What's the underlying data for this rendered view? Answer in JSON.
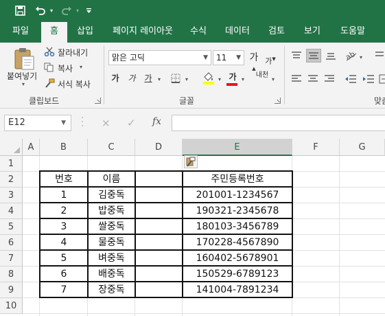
{
  "quick_access": {
    "save_icon": "save-icon",
    "undo_icon": "undo-icon",
    "redo_icon": "redo-icon",
    "customize_icon": "customize-qat-icon"
  },
  "tabs": [
    "파일",
    "홈",
    "삽입",
    "페이지 레이아웃",
    "수식",
    "데이터",
    "검토",
    "보기",
    "도움말"
  ],
  "active_tab": "홈",
  "ribbon": {
    "clipboard": {
      "paste_label": "붙여넣기",
      "cut_label": "잘라내기",
      "copy_label": "복사",
      "format_painter_label": "서식 복사",
      "group_label": "클립보드"
    },
    "font": {
      "font_name": "맑은 고딕",
      "font_size": "11",
      "grow_label": "가",
      "shrink_label": "가",
      "bold_label": "가",
      "italic_label": "가",
      "underline_label": "가",
      "font_color_label": "가",
      "phonetic_label": "내천",
      "group_label": "글꼴",
      "font_color": "#e81123",
      "fill_color": "#ffff00"
    },
    "alignment": {
      "group_label_partial": "맞춤"
    }
  },
  "formula_bar": {
    "name_box": "E12",
    "cancel_icon": "×",
    "enter_icon": "✓",
    "fx_label": "fx",
    "formula": ""
  },
  "sheet": {
    "columns": [
      "A",
      "B",
      "C",
      "D",
      "E",
      "F",
      "G"
    ],
    "selected_column": "E",
    "rows": [
      "1",
      "2",
      "3",
      "4",
      "5",
      "6",
      "7",
      "8",
      "9",
      "10"
    ],
    "header": {
      "b": "번호",
      "c": "이름",
      "d": "",
      "e": "주민등록번호"
    },
    "records": [
      {
        "b": "1",
        "c": "김중독",
        "e": "201001-1234567"
      },
      {
        "b": "2",
        "c": "밥중독",
        "e": "190321-2345678"
      },
      {
        "b": "3",
        "c": "쌀중독",
        "e": "180103-3456789"
      },
      {
        "b": "4",
        "c": "물중독",
        "e": "170228-4567890"
      },
      {
        "b": "5",
        "c": "벼중독",
        "e": "160402-5678901"
      },
      {
        "b": "6",
        "c": "배중독",
        "e": "150529-6789123"
      },
      {
        "b": "7",
        "c": "장중독",
        "e": "141004-7891234"
      }
    ]
  },
  "accent_color": "#217346"
}
